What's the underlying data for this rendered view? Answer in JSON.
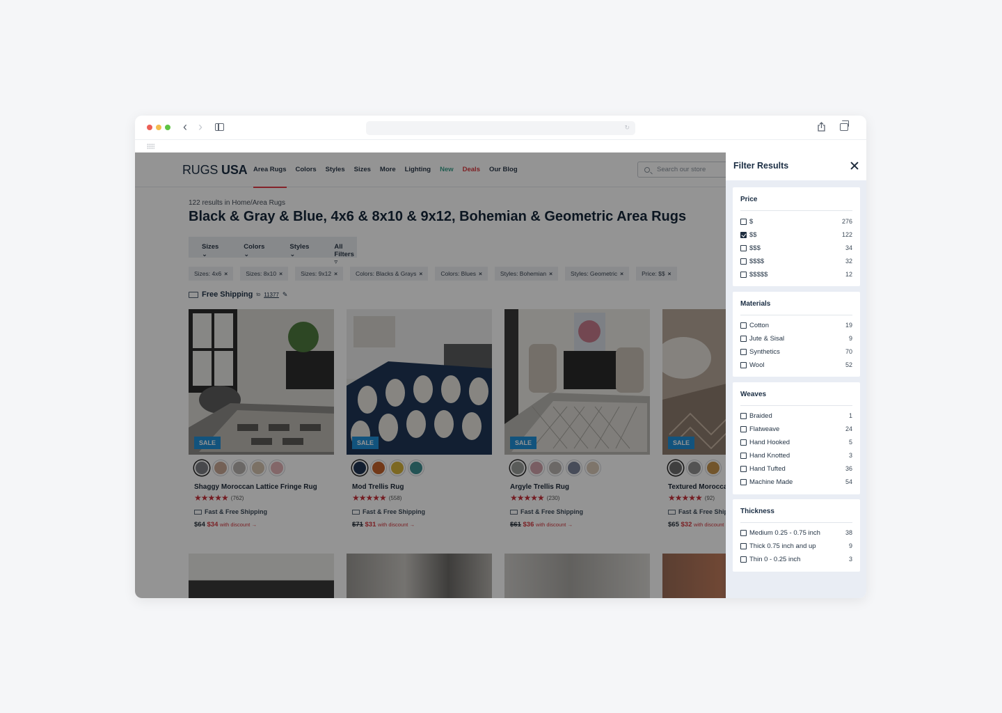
{
  "site": {
    "logo_word": "RUGS",
    "logo_word2": "USA",
    "nav": [
      "Area Rugs",
      "Colors",
      "Styles",
      "Sizes",
      "More",
      "Lighting",
      "New",
      "Deals",
      "Our Blog"
    ],
    "search_placeholder": "Search our store",
    "crumb": "122 results in Home/Area Rugs",
    "title": "Black & Gray & Blue, 4x6 & 8x10 & 9x12, Bohemian & Geometric Area Rugs",
    "filters": [
      "Sizes",
      "Colors",
      "Styles",
      "All Filters"
    ],
    "chips": [
      "Sizes: 4x6",
      "Sizes: 8x10",
      "Sizes: 9x12",
      "Colors: Blacks & Grays",
      "Colors: Blues",
      "Styles: Bohemian",
      "Styles: Geometric",
      "Price: $$"
    ],
    "chip_remove": "×",
    "free_shipping": "Free Shipping",
    "ship_to": "to",
    "zip": "11377",
    "sale_label": "SALE",
    "with_discount": "with discount →",
    "fast_free": "Fast & Free Shipping",
    "products": [
      {
        "name": "Shaggy Moroccan Lattice Fringe Rug",
        "reviews": "(762)",
        "price": "$64",
        "discount": "$34",
        "swatches": [
          "#7c7f83",
          "#c9a794",
          "#b7b2ae",
          "#d5c3ae",
          "#e2b1b6"
        ]
      },
      {
        "name": "Mod Trellis Rug",
        "reviews": "(558)",
        "price": "$71",
        "discount": "$31",
        "swatches": [
          "#1f3553",
          "#c4622b",
          "#d6b33b",
          "#3d8f93"
        ]
      },
      {
        "name": "Argyle Trellis Rug",
        "reviews": "(230)",
        "price": "$61",
        "discount": "$36",
        "swatches": [
          "#9a9d99",
          "#d1a3ab",
          "#b9b4b0",
          "#7a8399",
          "#d9cab8"
        ]
      },
      {
        "name": "Textured Morocca",
        "reviews": "(92)",
        "price": "$65",
        "discount": "$32",
        "swatches": [
          "#6d6d6d",
          "#8f8f8f",
          "#c5934c"
        ]
      }
    ]
  },
  "panel": {
    "title": "Filter Results",
    "sections": [
      {
        "title": "Price",
        "options": [
          {
            "label": "$",
            "count": "276",
            "checked": false
          },
          {
            "label": "$$",
            "count": "122",
            "checked": true
          },
          {
            "label": "$$$",
            "count": "34",
            "checked": false
          },
          {
            "label": "$$$$",
            "count": "32",
            "checked": false
          },
          {
            "label": "$$$$$",
            "count": "12",
            "checked": false
          }
        ]
      },
      {
        "title": "Materials",
        "options": [
          {
            "label": "Cotton",
            "count": "19",
            "checked": false
          },
          {
            "label": "Jute & Sisal",
            "count": "9",
            "checked": false
          },
          {
            "label": "Synthetics",
            "count": "70",
            "checked": false
          },
          {
            "label": "Wool",
            "count": "52",
            "checked": false
          }
        ]
      },
      {
        "title": "Weaves",
        "options": [
          {
            "label": "Braided",
            "count": "1",
            "checked": false
          },
          {
            "label": "Flatweave",
            "count": "24",
            "checked": false
          },
          {
            "label": "Hand Hooked",
            "count": "5",
            "checked": false
          },
          {
            "label": "Hand Knotted",
            "count": "3",
            "checked": false
          },
          {
            "label": "Hand Tufted",
            "count": "36",
            "checked": false
          },
          {
            "label": "Machine Made",
            "count": "54",
            "checked": false
          }
        ]
      },
      {
        "title": "Thickness",
        "options": [
          {
            "label": "Medium 0.25 - 0.75 inch",
            "count": "38",
            "checked": false
          },
          {
            "label": "Thick 0.75 inch and up",
            "count": "9",
            "checked": false
          },
          {
            "label": "Thin 0 - 0.25 inch",
            "count": "3",
            "checked": false
          }
        ]
      }
    ]
  }
}
